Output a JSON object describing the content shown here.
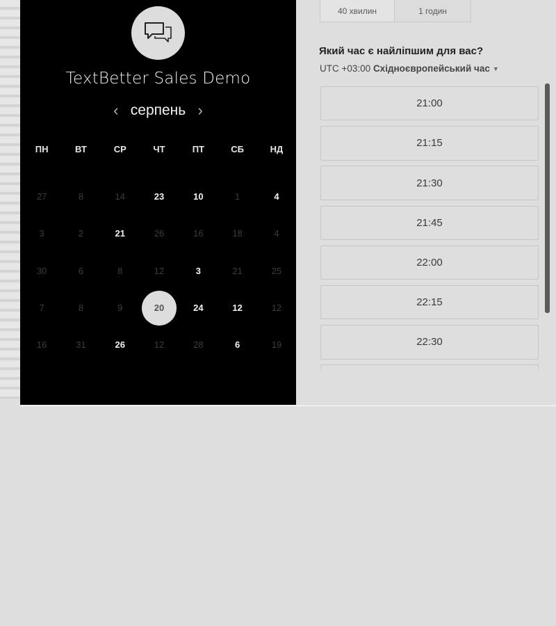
{
  "event": {
    "title": "TextBetter Sales Demo",
    "icon": "chat-bubbles-icon"
  },
  "calendar": {
    "month": "серпень",
    "weekdays": [
      "ПН",
      "ВТ",
      "СР",
      "ЧТ",
      "ПТ",
      "СБ",
      "НД"
    ],
    "weeks": [
      [
        {
          "d": "27",
          "on": false
        },
        {
          "d": "8",
          "on": false
        },
        {
          "d": "14",
          "on": false
        },
        {
          "d": "23",
          "on": true
        },
        {
          "d": "10",
          "on": true
        },
        {
          "d": "1",
          "on": false
        },
        {
          "d": "4",
          "on": true
        }
      ],
      [
        {
          "d": "3",
          "on": false
        },
        {
          "d": "2",
          "on": false
        },
        {
          "d": "21",
          "on": true
        },
        {
          "d": "26",
          "on": false
        },
        {
          "d": "16",
          "on": false
        },
        {
          "d": "18",
          "on": false
        },
        {
          "d": "4",
          "on": false
        }
      ],
      [
        {
          "d": "30",
          "on": false
        },
        {
          "d": "6",
          "on": false
        },
        {
          "d": "8",
          "on": false
        },
        {
          "d": "12",
          "on": false
        },
        {
          "d": "3",
          "on": true
        },
        {
          "d": "21",
          "on": false
        },
        {
          "d": "25",
          "on": false
        }
      ],
      [
        {
          "d": "7",
          "on": false
        },
        {
          "d": "8",
          "on": false
        },
        {
          "d": "9",
          "on": false
        },
        {
          "d": "20",
          "on": true,
          "selected": true
        },
        {
          "d": "24",
          "on": true
        },
        {
          "d": "12",
          "on": true
        },
        {
          "d": "12",
          "on": false
        }
      ],
      [
        {
          "d": "16",
          "on": false
        },
        {
          "d": "31",
          "on": false
        },
        {
          "d": "26",
          "on": true
        },
        {
          "d": "12",
          "on": false
        },
        {
          "d": "28",
          "on": false
        },
        {
          "d": "6",
          "on": true
        },
        {
          "d": "19",
          "on": false
        }
      ]
    ]
  },
  "durations": [
    {
      "label": "40 хвилин",
      "selected": true
    },
    {
      "label": "1 годин",
      "selected": false
    }
  ],
  "question": "Який час є найліпшим для вас?",
  "timezone": {
    "offset": "UTC +03:00",
    "name": "Східноєвропейський час"
  },
  "slots": [
    "21:00",
    "21:15",
    "21:30",
    "21:45",
    "22:00",
    "22:15",
    "22:30",
    ""
  ]
}
